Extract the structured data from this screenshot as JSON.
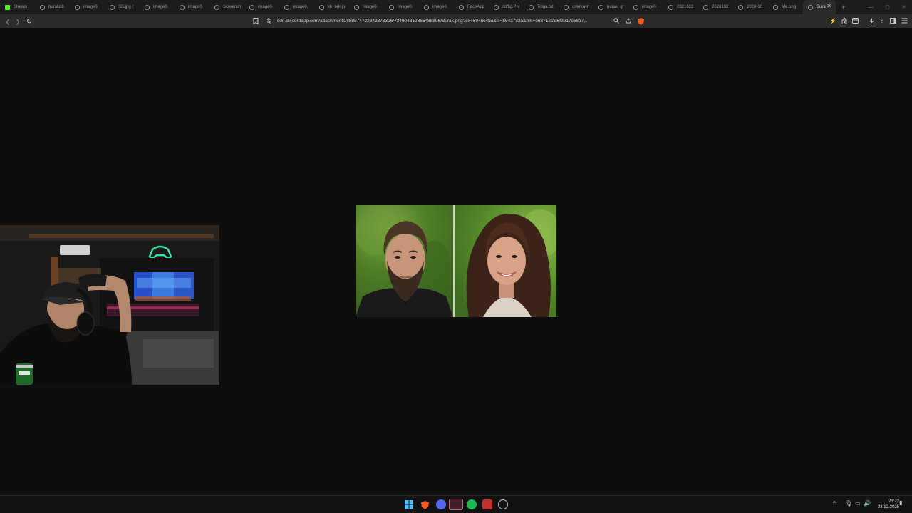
{
  "browser": {
    "tabs": [
      {
        "label": "Stream",
        "favicon": "kick-icon"
      },
      {
        "label": "burakab",
        "favicon": "globe-icon"
      },
      {
        "label": "image0",
        "favicon": "globe-icon"
      },
      {
        "label": "SS.jpg (",
        "favicon": "globe-icon"
      },
      {
        "label": "image0.",
        "favicon": "globe-icon"
      },
      {
        "label": "image0.",
        "favicon": "globe-icon"
      },
      {
        "label": "Screensh",
        "favicon": "globe-icon"
      },
      {
        "label": "image0.",
        "favicon": "globe-icon"
      },
      {
        "label": "image0.",
        "favicon": "globe-icon"
      },
      {
        "label": "kh_brk.jp",
        "favicon": "globe-icon"
      },
      {
        "label": "image0.",
        "favicon": "globe-icon"
      },
      {
        "label": "image0.",
        "favicon": "globe-icon"
      },
      {
        "label": "image0.",
        "favicon": "globe-icon"
      },
      {
        "label": "FaceApp",
        "favicon": "globe-icon"
      },
      {
        "label": "stiffig.PN",
        "favicon": "globe-icon"
      },
      {
        "label": "Tolga.fot",
        "favicon": "globe-icon"
      },
      {
        "label": "unknown",
        "favicon": "globe-icon"
      },
      {
        "label": "burak_gr",
        "favicon": "globe-icon"
      },
      {
        "label": "image0.",
        "favicon": "globe-icon"
      },
      {
        "label": "2021022",
        "favicon": "globe-icon"
      },
      {
        "label": "2020102",
        "favicon": "globe-icon"
      },
      {
        "label": "2020-10",
        "favicon": "globe-icon"
      },
      {
        "label": "efe.png",
        "favicon": "globe-icon"
      },
      {
        "label": "Bura",
        "favicon": "globe-icon",
        "active": true
      }
    ],
    "new_tab": "+",
    "url": "cdn.discordapp.com/attachments/688874722842378306/734904312865488896/Burak.png?ex=694bc4ba&is=694a733a&hm=e68712cfd6f9917c68a7..."
  },
  "taskbar": {
    "clock_time": "23:22",
    "clock_date": "23.12.2025"
  },
  "colors": {
    "tab_bar": "#1c1c1d",
    "toolbar": "#2b2b2c",
    "viewport": "#0e0e0e",
    "kick_green": "#53fc18",
    "brave_orange": "#f15a24"
  }
}
